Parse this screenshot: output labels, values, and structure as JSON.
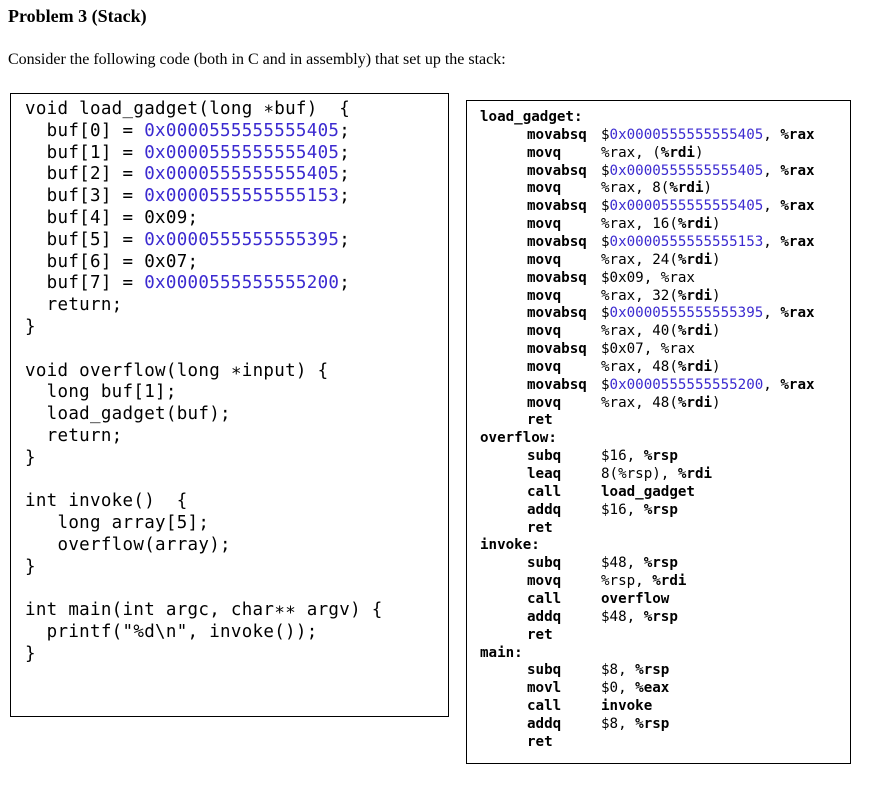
{
  "heading": "Problem 3 (Stack)",
  "intro": "Consider the following code (both in C and in assembly) that set up the stack:",
  "c_code": [
    [
      {
        "t": "void load_gadget(long "
      },
      {
        "t": "∗"
      },
      {
        "t": "buf)  {"
      }
    ],
    [
      {
        "t": "  buf[0] = "
      },
      {
        "t": "0x0000555555555405",
        "c": "num"
      },
      {
        "t": ";"
      }
    ],
    [
      {
        "t": "  buf[1] = "
      },
      {
        "t": "0x0000555555555405",
        "c": "num"
      },
      {
        "t": ";"
      }
    ],
    [
      {
        "t": "  buf[2] = "
      },
      {
        "t": "0x0000555555555405",
        "c": "num"
      },
      {
        "t": ";"
      }
    ],
    [
      {
        "t": "  buf[3] = "
      },
      {
        "t": "0x0000555555555153",
        "c": "num"
      },
      {
        "t": ";"
      }
    ],
    [
      {
        "t": "  buf[4] = 0x09;"
      }
    ],
    [
      {
        "t": "  buf[5] = "
      },
      {
        "t": "0x0000555555555395",
        "c": "num"
      },
      {
        "t": ";"
      }
    ],
    [
      {
        "t": "  buf[6] = 0x07;"
      }
    ],
    [
      {
        "t": "  buf[7] = "
      },
      {
        "t": "0x0000555555555200",
        "c": "num"
      },
      {
        "t": ";"
      }
    ],
    [
      {
        "t": "  return;"
      }
    ],
    [
      {
        "t": "}"
      }
    ],
    [
      {
        "t": ""
      }
    ],
    [
      {
        "t": "void overflow(long "
      },
      {
        "t": "∗"
      },
      {
        "t": "input) {"
      }
    ],
    [
      {
        "t": "  long buf[1];"
      }
    ],
    [
      {
        "t": "  load_gadget(buf);"
      }
    ],
    [
      {
        "t": "  return;"
      }
    ],
    [
      {
        "t": "}"
      }
    ],
    [
      {
        "t": ""
      }
    ],
    [
      {
        "t": "int invoke()  {"
      }
    ],
    [
      {
        "t": "   long array[5];"
      }
    ],
    [
      {
        "t": "   overflow(array);"
      }
    ],
    [
      {
        "t": "}"
      }
    ],
    [
      {
        "t": ""
      }
    ],
    [
      {
        "t": "int main(int argc, char"
      },
      {
        "t": "∗∗"
      },
      {
        "t": " argv) {"
      }
    ],
    [
      {
        "t": "  printf(\"%d\\n\", invoke());"
      }
    ],
    [
      {
        "t": "}"
      }
    ]
  ],
  "asm_code": [
    {
      "label": "load_gadget:"
    },
    {
      "op": "movabsq",
      "args": [
        {
          "t": "$"
        },
        {
          "t": "0x0000555555555405",
          "c": "num"
        },
        {
          "t": ", "
        },
        {
          "t": "%rax",
          "c": "reg"
        }
      ]
    },
    {
      "op": "movq",
      "args": [
        {
          "t": "%rax, ("
        },
        {
          "t": "%rdi",
          "c": "reg"
        },
        {
          "t": ")"
        }
      ]
    },
    {
      "op": "movabsq",
      "args": [
        {
          "t": "$"
        },
        {
          "t": "0x0000555555555405",
          "c": "num"
        },
        {
          "t": ", "
        },
        {
          "t": "%rax",
          "c": "reg"
        }
      ]
    },
    {
      "op": "movq",
      "args": [
        {
          "t": "%rax, 8("
        },
        {
          "t": "%rdi",
          "c": "reg"
        },
        {
          "t": ")"
        }
      ]
    },
    {
      "op": "movabsq",
      "args": [
        {
          "t": "$"
        },
        {
          "t": "0x0000555555555405",
          "c": "num"
        },
        {
          "t": ", "
        },
        {
          "t": "%rax",
          "c": "reg"
        }
      ]
    },
    {
      "op": "movq",
      "args": [
        {
          "t": "%rax, 16("
        },
        {
          "t": "%rdi",
          "c": "reg"
        },
        {
          "t": ")"
        }
      ]
    },
    {
      "op": "movabsq",
      "args": [
        {
          "t": "$"
        },
        {
          "t": "0x0000555555555153",
          "c": "num"
        },
        {
          "t": ", "
        },
        {
          "t": "%rax",
          "c": "reg"
        }
      ]
    },
    {
      "op": "movq",
      "args": [
        {
          "t": "%rax, 24("
        },
        {
          "t": "%rdi",
          "c": "reg"
        },
        {
          "t": ")"
        }
      ]
    },
    {
      "op": "movabsq",
      "args": [
        {
          "t": "$0x09, %rax"
        }
      ]
    },
    {
      "op": "movq",
      "args": [
        {
          "t": "%rax, 32("
        },
        {
          "t": "%rdi",
          "c": "reg"
        },
        {
          "t": ")"
        }
      ]
    },
    {
      "op": "movabsq",
      "args": [
        {
          "t": "$"
        },
        {
          "t": "0x0000555555555395",
          "c": "num"
        },
        {
          "t": ", "
        },
        {
          "t": "%rax",
          "c": "reg"
        }
      ]
    },
    {
      "op": "movq",
      "args": [
        {
          "t": "%rax, 40("
        },
        {
          "t": "%rdi",
          "c": "reg"
        },
        {
          "t": ")"
        }
      ]
    },
    {
      "op": "movabsq",
      "args": [
        {
          "t": "$0x07, %rax"
        }
      ]
    },
    {
      "op": "movq",
      "args": [
        {
          "t": "%rax, 48("
        },
        {
          "t": "%rdi",
          "c": "reg"
        },
        {
          "t": ")"
        }
      ]
    },
    {
      "op": "movabsq",
      "args": [
        {
          "t": "$"
        },
        {
          "t": "0x0000555555555200",
          "c": "num"
        },
        {
          "t": ", "
        },
        {
          "t": "%rax",
          "c": "reg"
        }
      ]
    },
    {
      "op": "movq",
      "args": [
        {
          "t": "%rax, 48("
        },
        {
          "t": "%rdi",
          "c": "reg"
        },
        {
          "t": ")"
        }
      ]
    },
    {
      "op": "ret",
      "args": []
    },
    {
      "label": "overflow:"
    },
    {
      "op": "subq",
      "args": [
        {
          "t": "$16, "
        },
        {
          "t": "%rsp",
          "c": "reg"
        }
      ]
    },
    {
      "op": "leaq",
      "args": [
        {
          "t": "8(%rsp), "
        },
        {
          "t": "%rdi",
          "c": "reg"
        }
      ]
    },
    {
      "op": "call",
      "args": [
        {
          "t": "load_gadget",
          "c": "reg"
        }
      ]
    },
    {
      "op": "addq",
      "args": [
        {
          "t": "$16, "
        },
        {
          "t": "%rsp",
          "c": "reg"
        }
      ]
    },
    {
      "op": "ret",
      "args": []
    },
    {
      "label": "invoke:"
    },
    {
      "op": "subq",
      "args": [
        {
          "t": "$48, "
        },
        {
          "t": "%rsp",
          "c": "reg"
        }
      ]
    },
    {
      "op": "movq",
      "args": [
        {
          "t": "%rsp, "
        },
        {
          "t": "%rdi",
          "c": "reg"
        }
      ]
    },
    {
      "op": "call",
      "args": [
        {
          "t": "overflow",
          "c": "reg"
        }
      ]
    },
    {
      "op": "addq",
      "args": [
        {
          "t": "$48, "
        },
        {
          "t": "%rsp",
          "c": "reg"
        }
      ]
    },
    {
      "op": "ret",
      "args": []
    },
    {
      "label": "main:"
    },
    {
      "op": "subq",
      "args": [
        {
          "t": "$8, "
        },
        {
          "t": "%rsp",
          "c": "reg"
        }
      ]
    },
    {
      "op": "movl",
      "args": [
        {
          "t": "$0, "
        },
        {
          "t": "%eax",
          "c": "reg"
        }
      ]
    },
    {
      "op": "call",
      "args": [
        {
          "t": "invoke",
          "c": "reg"
        }
      ]
    },
    {
      "op": "addq",
      "args": [
        {
          "t": "$8, "
        },
        {
          "t": "%rsp",
          "c": "reg"
        }
      ]
    },
    {
      "op": "ret",
      "args": []
    }
  ]
}
